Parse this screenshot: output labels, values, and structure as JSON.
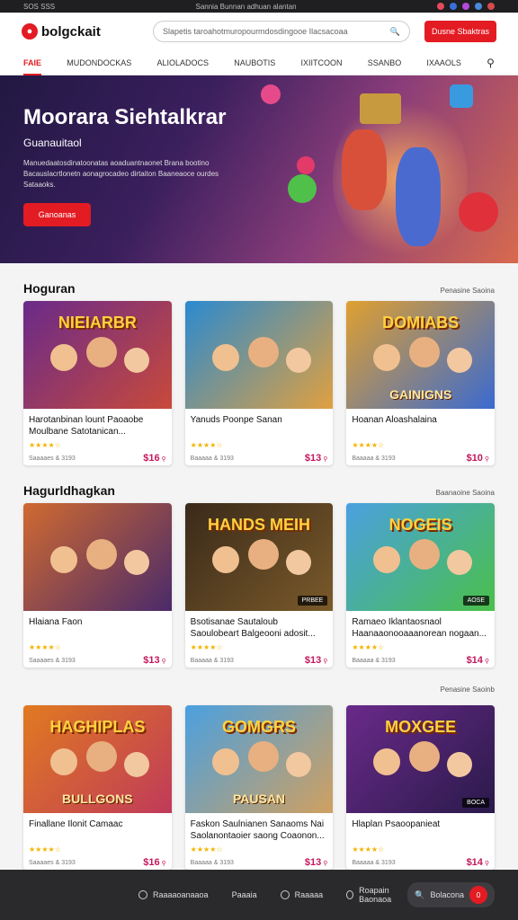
{
  "topbar": {
    "left_text": "SOS SSS",
    "center_text": "Sannia Bunnan adhuan alantan"
  },
  "header": {
    "logo_text": "bolgckait",
    "search_placeholder": "Slapetis taroahotmuropourmdosdingooe Ilacsacoaa",
    "signup_label": "Dusne Sbaktras"
  },
  "nav": {
    "items": [
      "FAIE",
      "MUDONDOCKAS",
      "ALIOLADOCS",
      "NAUBOTIS",
      "IXIITCOON",
      "SSANBO",
      "IXAAOLS"
    ]
  },
  "hero": {
    "title": "Moorara Siehtalkrar",
    "subtitle": "Guanauitaol",
    "description": "Manuedaatosdinatoonatas aoaduantnaonet Brana bootino Bacauslacrtlonetn aonagrocadeo dirtaiton Baaneaoce ourdes Sataaoks.",
    "button_label": "Ganoanas"
  },
  "sections": [
    {
      "title": "Hoguran",
      "link": "Penasine Saoina",
      "cards": [
        {
          "thumb_title": "NIEIARBR",
          "thumb_sub": "",
          "title": "Harotanbinan lount Paoaobe Moulbane Satotanican...",
          "stars": "★★★★☆",
          "meta": "Saaaaes & 3193",
          "price": "$16"
        },
        {
          "thumb_title": "",
          "thumb_sub": "",
          "title": "Yanuds Poonpe Sanan",
          "stars": "★★★★☆",
          "meta": "Baaaaa & 3193",
          "price": "$13"
        },
        {
          "thumb_title": "DOMIABS",
          "thumb_sub": "GAINIGNS",
          "title": "Hoanan Aloashalaina",
          "stars": "★★★★☆",
          "meta": "Baaaaa & 3193",
          "price": "$10"
        }
      ]
    },
    {
      "title": "Hagurldhagkan",
      "link": "Baanaoine Saoina",
      "cards": [
        {
          "thumb_title": "",
          "thumb_sub": "",
          "title": "Hlaiana Faon",
          "stars": "★★★★☆",
          "meta": "Saaaaes & 3193",
          "price": "$13"
        },
        {
          "thumb_title": "HANDS MEIH",
          "thumb_sub": "",
          "badge": "PRBEE",
          "title": "Bsotisanae Sautaloub Saoulobeart Balgeooni adosit...",
          "stars": "★★★★☆",
          "meta": "Baaaaa & 3193",
          "price": "$13"
        },
        {
          "thumb_title": "NOGEIS",
          "thumb_sub": "",
          "badge": "AOSE",
          "title": "Ramaeo Iklantaosnaol Haanaaonooaaanorean nogaan...",
          "stars": "★★★★☆",
          "meta": "Baaaaa & 3193",
          "price": "$14"
        }
      ]
    },
    {
      "title": "",
      "link": "Penasine Saoinb",
      "cards": [
        {
          "thumb_title": "HAGHIPLAS",
          "thumb_sub": "BULLGONS",
          "title": "Finallane Ilonit Camaac",
          "stars": "★★★★☆",
          "meta": "Saaaaes & 3193",
          "price": "$16"
        },
        {
          "thumb_title": "GOMGRS",
          "thumb_sub": "PAUSAN",
          "title": "Faskon Saulnianen Sanaoms Nai Saolanontaoier saong Coaonon...",
          "stars": "★★★★☆",
          "meta": "Baaaaa & 3193",
          "price": "$13"
        },
        {
          "thumb_title": "MOXGEE",
          "thumb_sub": "",
          "badge": "BOCA",
          "title": "Hlaplan Psaoopanieat",
          "stars": "★★★★☆",
          "meta": "Baaaaa & 3193",
          "price": "$14"
        }
      ]
    }
  ],
  "footer": {
    "items": [
      "Raaaaoanaaoa",
      "Paaaia",
      "Raaaaa",
      "Roapain Baonaoa"
    ],
    "chat_label": "Bolacona",
    "chat_count": "0"
  }
}
